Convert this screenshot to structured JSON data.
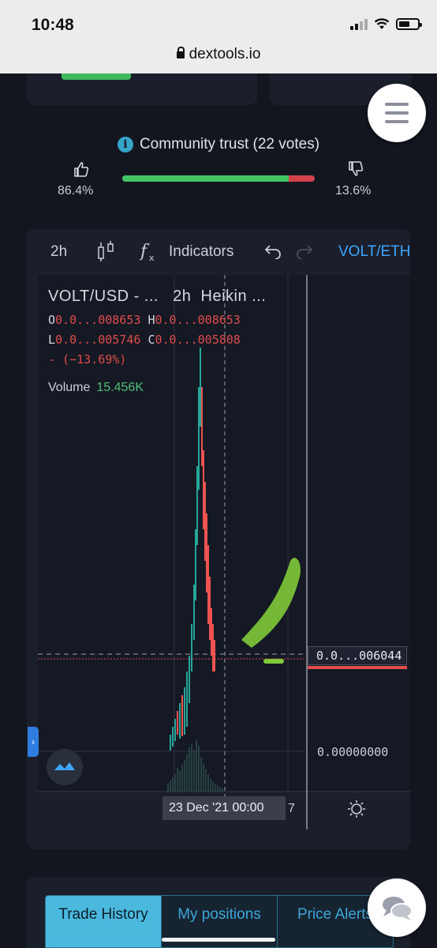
{
  "status_bar": {
    "time": "10:48"
  },
  "browser": {
    "url": "dextools.io"
  },
  "community": {
    "title": "Community trust (22 votes)",
    "up_percent": "86.4%",
    "down_percent": "13.6%",
    "up_fraction": 0.864
  },
  "chart_toolbar": {
    "interval": "2h",
    "indicators_label": "Indicators",
    "pair_label": "VOLT/ETH"
  },
  "chart_legend": {
    "title": "VOLT/USD - ...",
    "interval": "2h",
    "style": "Heikin ...",
    "open_label": "O",
    "open_value": "0.0...008653",
    "high_label": "H",
    "high_value": "0.0...008653",
    "low_label": "L",
    "low_value": "0.0...005746",
    "close_label": "C",
    "close_value": "0.0...005808",
    "change": "- (−13.69%)",
    "volume_label": "Volume",
    "volume_value": "15.456K"
  },
  "price_axis": {
    "current_price_tag": "0.0...006044",
    "zero_label": "0.00000000"
  },
  "time_axis": {
    "crosshair_label": "23 Dec '21   00:00",
    "trailing_label": "7"
  },
  "bottom_tabs": [
    "Trade History",
    "My positions",
    "Price Alerts"
  ],
  "colors": {
    "up": "#43c463",
    "down": "#d2424c",
    "accent": "#3ea6ff",
    "active_tab": "#4bb9dd",
    "candle_up": "#26a69a",
    "candle_down": "#ef5350",
    "annotation": "#7fc93a"
  }
}
